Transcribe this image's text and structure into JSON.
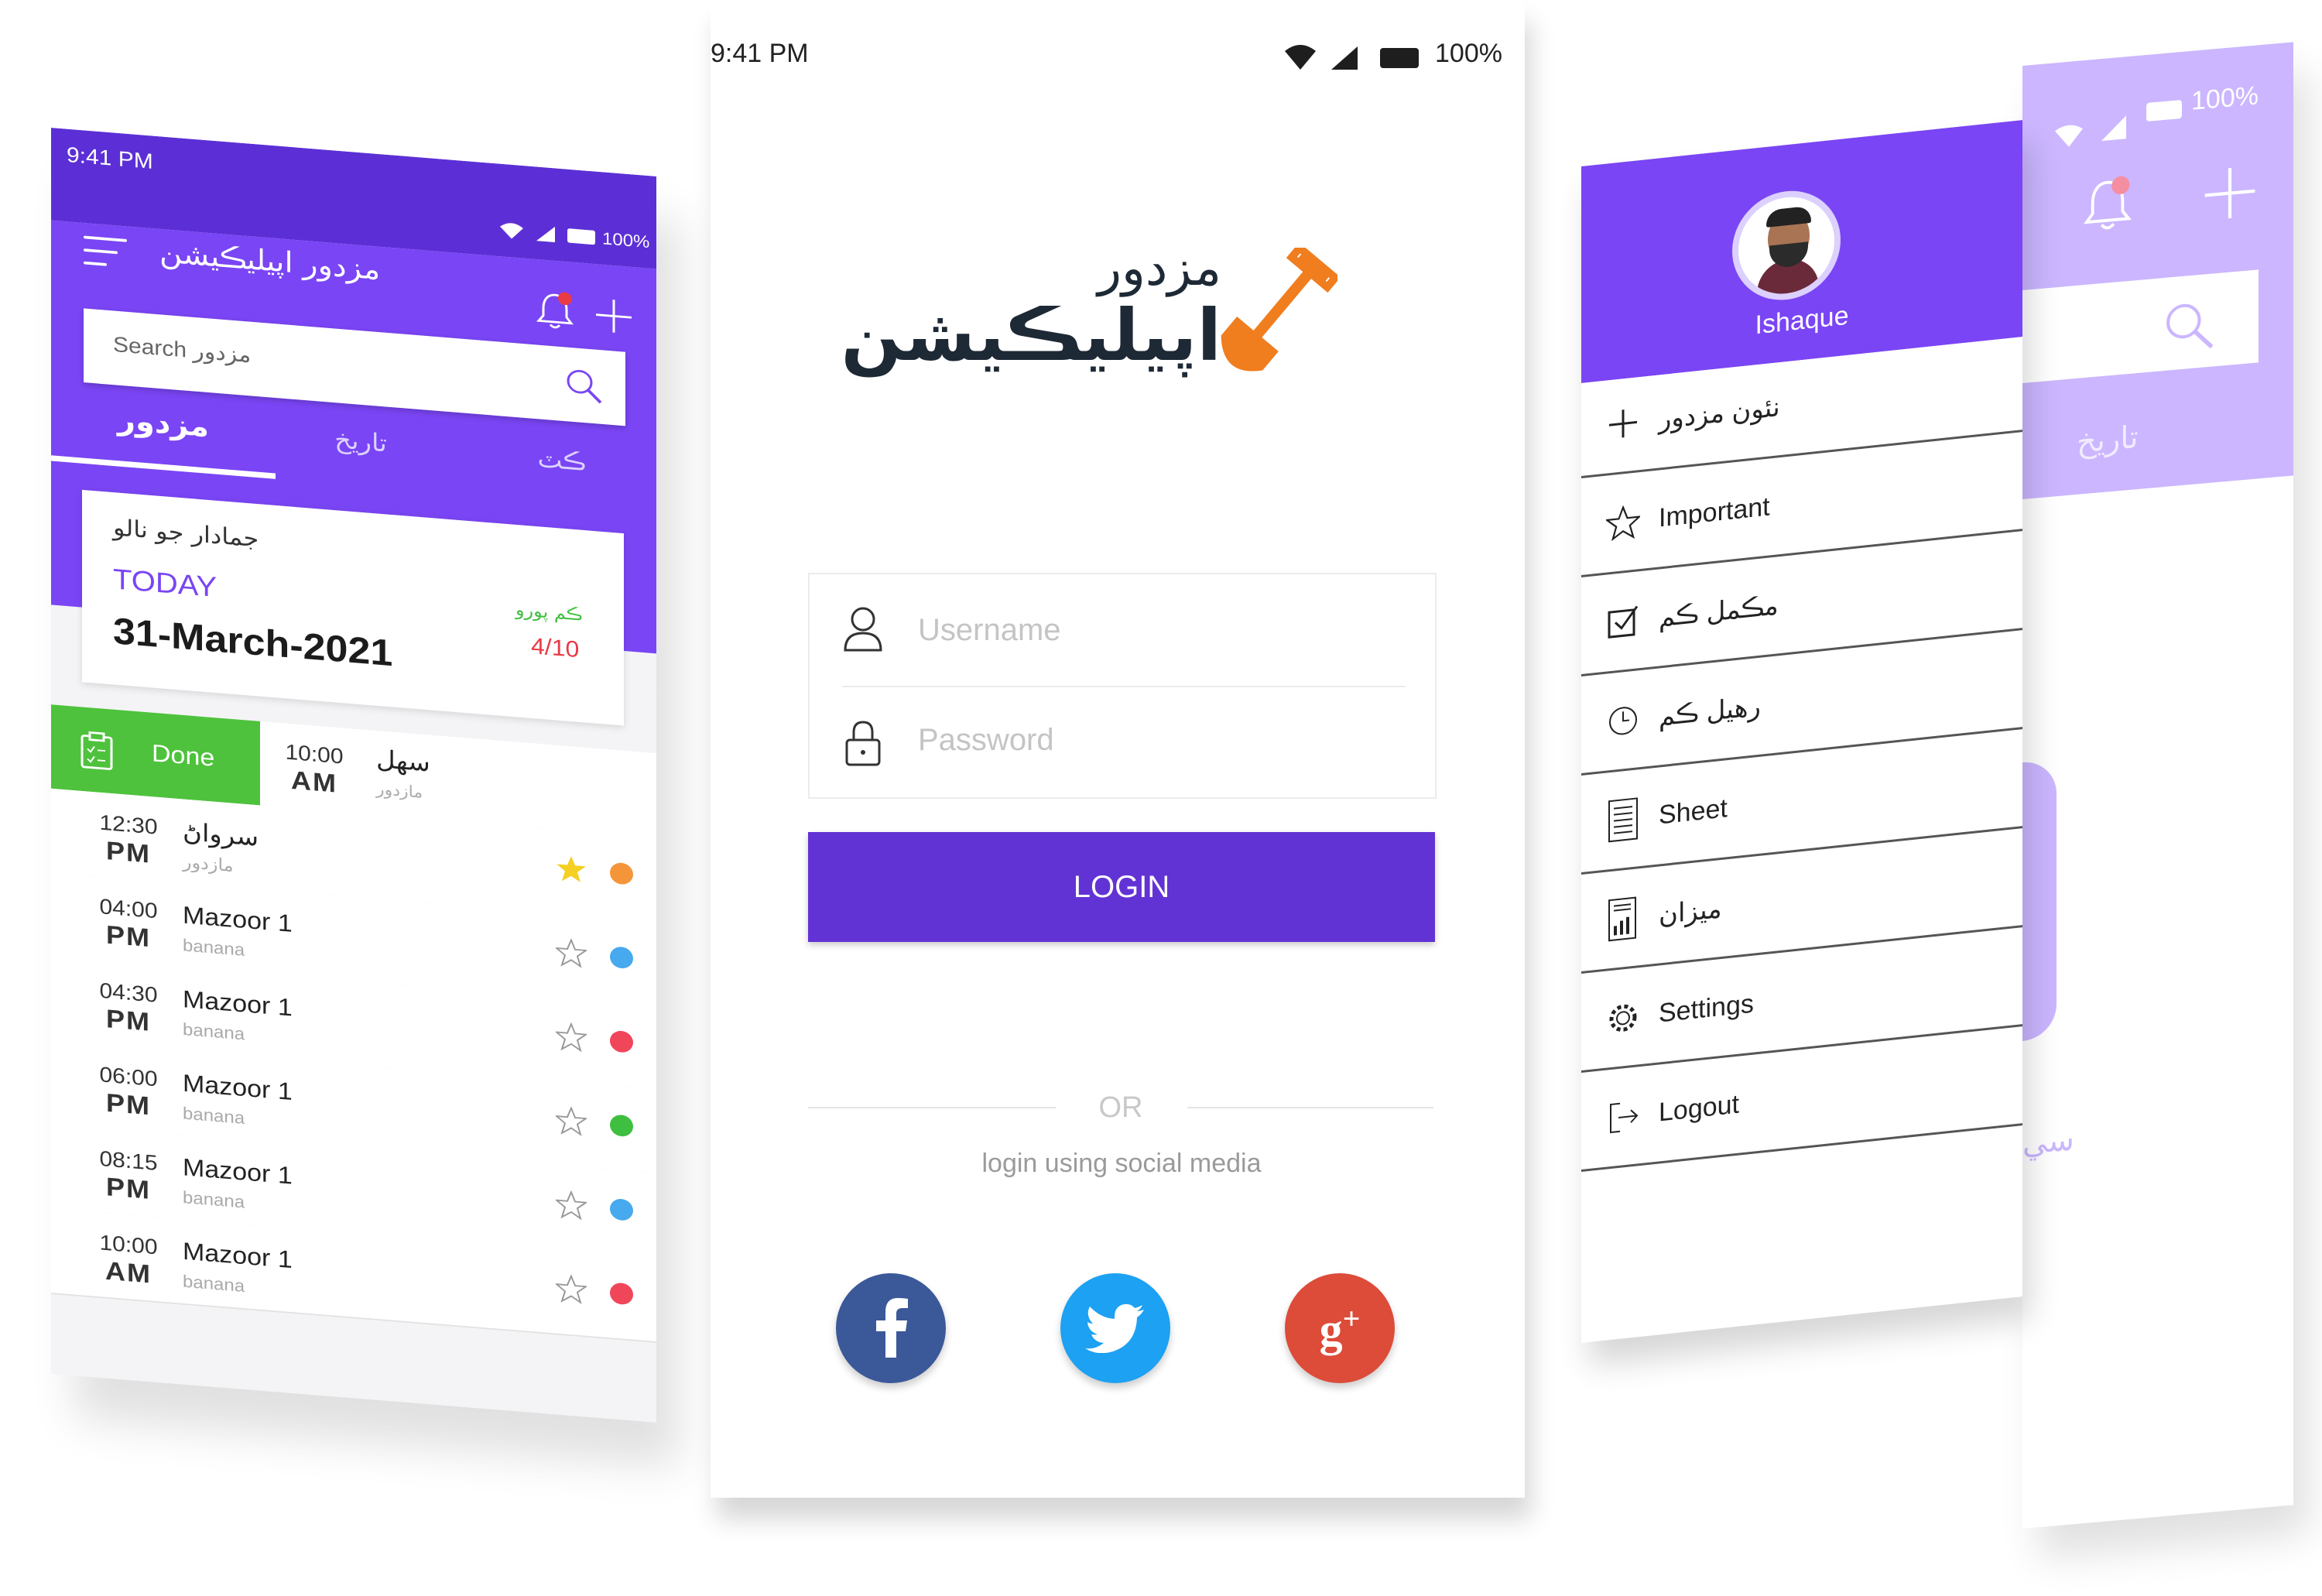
{
  "left_phone": {
    "status": {
      "time": "9:41 PM",
      "battery": "100%"
    },
    "header": {
      "title": "مزدور اپيليڪيشن"
    },
    "search": {
      "placeholder": "Search مزدور"
    },
    "tabs": [
      {
        "label": "مزدور",
        "active": true
      },
      {
        "label": "تاريخ",
        "active": false
      },
      {
        "label": "ڪٽ",
        "active": false
      }
    ],
    "summary": {
      "title": "جمادار جو نالو",
      "today_label": "TODAY",
      "date": "31-March-2021",
      "progress_label": "ڪم پورو",
      "progress_value": "4/10"
    },
    "done_row": {
      "badge": "Done",
      "time": "10:00",
      "ampm": "AM",
      "name": "سهل",
      "sub": "مازدور"
    },
    "tasks": [
      {
        "time": "12:30",
        "ampm": "PM",
        "name": "سرواڻ",
        "sub": "مازدور",
        "starred": true,
        "dot": "#f5953a"
      },
      {
        "time": "04:00",
        "ampm": "PM",
        "name": "Mazoor 1",
        "sub": "banana",
        "starred": false,
        "dot": "#47a9ee"
      },
      {
        "time": "04:30",
        "ampm": "PM",
        "name": "Mazoor 1",
        "sub": "banana",
        "starred": false,
        "dot": "#f0465a"
      },
      {
        "time": "06:00",
        "ampm": "PM",
        "name": "Mazoor 1",
        "sub": "banana",
        "starred": false,
        "dot": "#3fbf3f"
      },
      {
        "time": "08:15",
        "ampm": "PM",
        "name": "Mazoor 1",
        "sub": "banana",
        "starred": false,
        "dot": "#47a9ee"
      },
      {
        "time": "10:00",
        "ampm": "AM",
        "name": "Mazoor 1",
        "sub": "banana",
        "starred": false,
        "dot": "#f0465a"
      }
    ]
  },
  "center_phone": {
    "status": {
      "time": "9:41 PM",
      "battery": "100%"
    },
    "logo": {
      "line1": "مزدور",
      "line2": "اپيليڪيشن"
    },
    "form": {
      "username_placeholder": "Username",
      "password_placeholder": "Password",
      "login_button": "LOGIN"
    },
    "divider": {
      "or": "OR",
      "social_text": "login using social media"
    },
    "social": [
      {
        "name": "facebook",
        "color": "#3b5899"
      },
      {
        "name": "twitter",
        "color": "#1da1f2"
      },
      {
        "name": "google-plus",
        "color": "#dd4b39"
      }
    ]
  },
  "right_phone": {
    "status": {
      "battery": "100%"
    },
    "profile": {
      "name": "Ishaque"
    },
    "back_tab": "تاريخ",
    "back_fragment": "سي",
    "menu": [
      {
        "icon": "plus-icon",
        "label": "نئون مزدور"
      },
      {
        "icon": "star-icon",
        "label": "Important"
      },
      {
        "icon": "checkbox-icon",
        "label": "مڪمل ڪم"
      },
      {
        "icon": "clock-icon",
        "label": "رهيل ڪم"
      },
      {
        "icon": "sheet-icon",
        "label": "Sheet"
      },
      {
        "icon": "report-icon",
        "label": "ميزان"
      },
      {
        "icon": "gear-icon",
        "label": "Settings"
      },
      {
        "icon": "logout-icon",
        "label": "Logout"
      }
    ]
  },
  "colors": {
    "primary": "#7a45f4",
    "primary_dark": "#5c2fd6",
    "login": "#6233d4",
    "done": "#4ec23c",
    "logo_orange": "#f07d1e",
    "logo_dark": "#1e2936"
  }
}
